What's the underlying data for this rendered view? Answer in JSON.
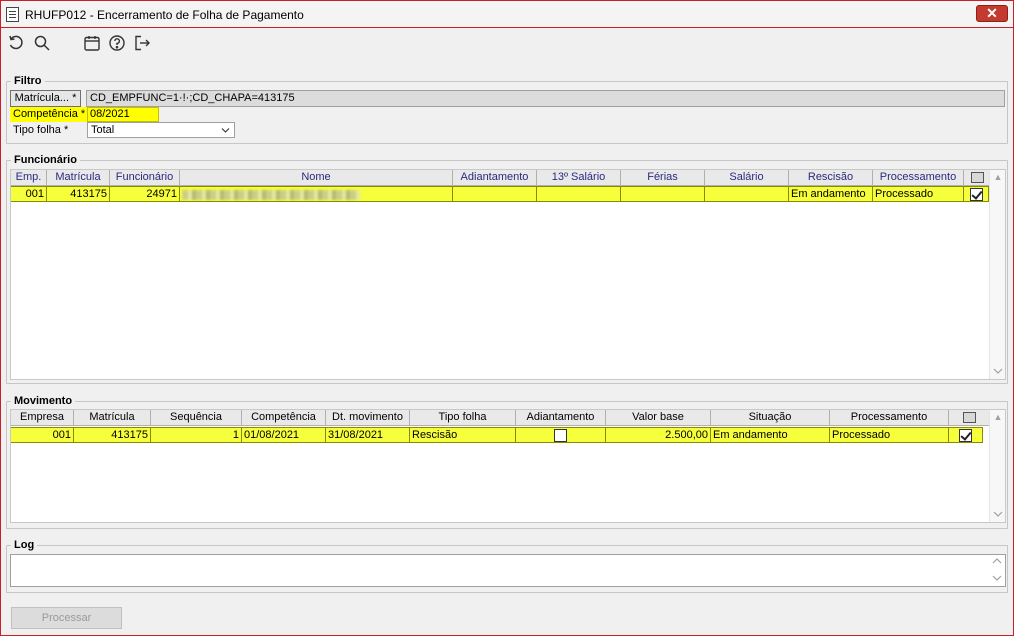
{
  "window": {
    "title": "RHUFP012 - Encerramento de Folha de Pagamento",
    "close_label": "✕"
  },
  "toolbar": {
    "icons": [
      "undo-icon",
      "search-icon",
      "calendar-icon",
      "help-icon",
      "exit-icon"
    ]
  },
  "filtro": {
    "label": "Filtro",
    "matricula_button": "Matrícula... *",
    "filter_value": "CD_EMPFUNC=1·!·;CD_CHAPA=413175",
    "competencia_label": "Competência *",
    "competencia_value": "08/2021",
    "tipo_folha_label": "Tipo folha *",
    "tipo_folha_value": "Total"
  },
  "funcionario": {
    "label": "Funcionário",
    "columns": [
      "Emp.",
      "Matrícula",
      "Funcionário",
      "Nome",
      "Adiantamento",
      "13º Salário",
      "Férias",
      "Salário",
      "Rescisão",
      "Processamento"
    ],
    "rows": [
      {
        "emp": "001",
        "matricula": "413175",
        "funcionario": "24971",
        "nome": "",
        "adiantamento": "",
        "decimo_terceiro": "",
        "ferias": "",
        "salario": "",
        "rescisao": "Em andamento",
        "processamento": "Processado",
        "selected": true
      }
    ]
  },
  "movimento": {
    "label": "Movimento",
    "columns": [
      "Empresa",
      "Matrícula",
      "Sequência",
      "Competência",
      "Dt. movimento",
      "Tipo folha",
      "Adiantamento",
      "Valor base",
      "Situação",
      "Processamento"
    ],
    "rows": [
      {
        "empresa": "001",
        "matricula": "413175",
        "sequencia": "1",
        "competencia": "01/08/2021",
        "dt_movimento": "31/08/2021",
        "tipo_folha": "Rescisão",
        "adiantamento": false,
        "valor_base": "2.500,00",
        "situacao": "Em andamento",
        "processamento": "Processado",
        "selected": true
      }
    ]
  },
  "log": {
    "label": "Log",
    "value": ""
  },
  "actions": {
    "processar_label": "Processar"
  },
  "colors": {
    "highlight": "#ffff00",
    "row_highlight": "#f6ff3c",
    "title_border": "#c8202a"
  }
}
